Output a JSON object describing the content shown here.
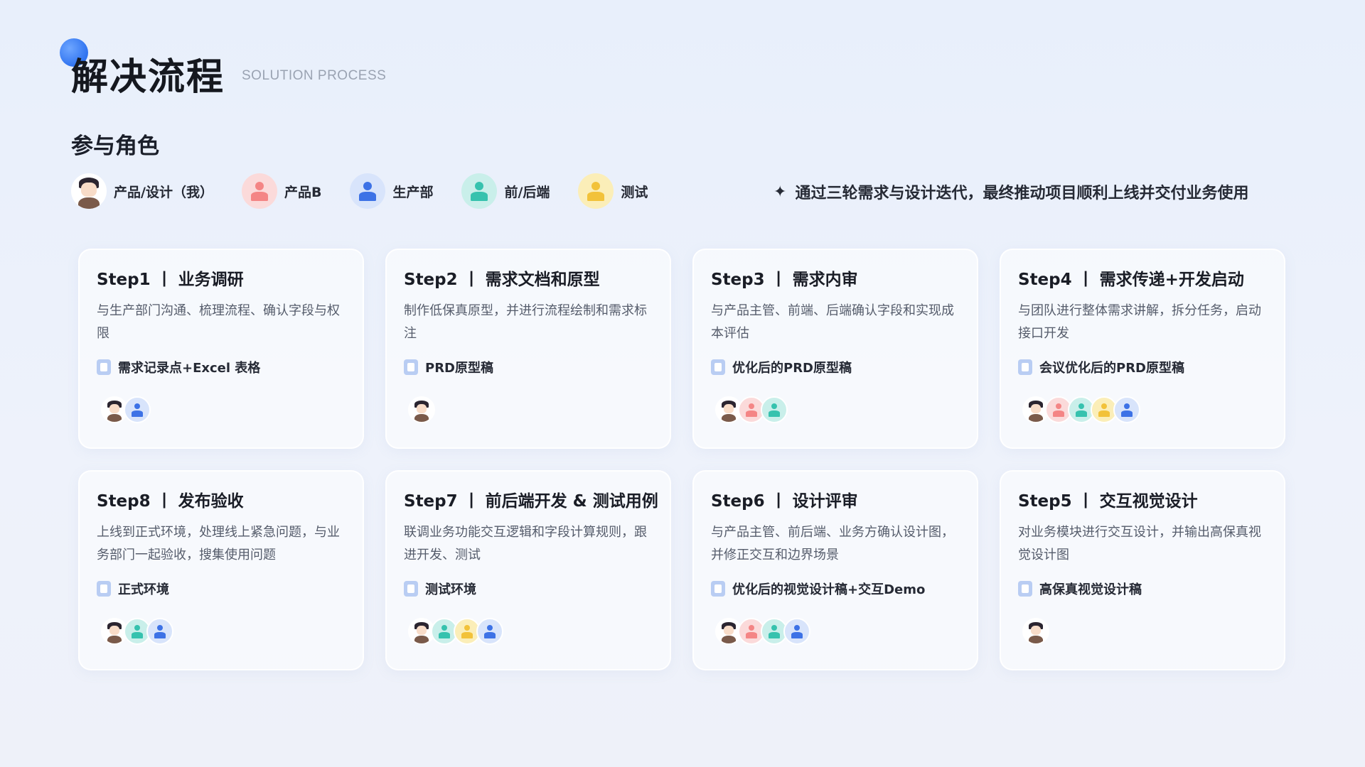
{
  "header": {
    "title": "解决流程",
    "subtitle": "SOLUTION PROCESS"
  },
  "roles_title": "参与角色",
  "roles": [
    {
      "key": "me",
      "label": "产品/设计（我）"
    },
    {
      "key": "pink",
      "label": "产品B"
    },
    {
      "key": "blue",
      "label": "生产部"
    },
    {
      "key": "teal",
      "label": "前/后端"
    },
    {
      "key": "yellow",
      "label": "测试"
    }
  ],
  "slogan": {
    "star": "✦",
    "text": "通过三轮需求与设计迭代，最终推动项目顺利上线并交付业务使用"
  },
  "steps": [
    {
      "title": "Step1 丨 业务调研",
      "desc": "与生产部门沟通、梳理流程、确认字段与权限",
      "doc": "需求记录点+Excel 表格",
      "people": [
        "me",
        "blue"
      ]
    },
    {
      "title": "Step2 丨 需求文档和原型",
      "desc": "制作低保真原型，并进行流程绘制和需求标注",
      "doc": "PRD原型稿",
      "people": [
        "me"
      ]
    },
    {
      "title": "Step3 丨 需求内审",
      "desc": "与产品主管、前端、后端确认字段和实现成本评估",
      "doc": "优化后的PRD原型稿",
      "people": [
        "me",
        "pink",
        "teal"
      ]
    },
    {
      "title": "Step4 丨 需求传递+开发启动",
      "desc": "与团队进行整体需求讲解，拆分任务，启动接口开发",
      "doc": "会议优化后的PRD原型稿",
      "people": [
        "me",
        "pink",
        "teal",
        "yellow",
        "blue"
      ]
    },
    {
      "title": "Step8 丨 发布验收",
      "desc": "上线到正式环境，处理线上紧急问题，与业务部门一起验收，搜集使用问题",
      "doc": "正式环境",
      "people": [
        "me",
        "teal",
        "blue"
      ]
    },
    {
      "title": "Step7 丨 前后端开发 & 测试用例",
      "desc": "联调业务功能交互逻辑和字段计算规则，跟进开发、测试",
      "doc": "测试环境",
      "people": [
        "me",
        "teal",
        "yellow",
        "blue"
      ]
    },
    {
      "title": "Step6 丨 设计评审",
      "desc": "与产品主管、前后端、业务方确认设计图，并修正交互和边界场景",
      "doc": "优化后的视觉设计稿+交互Demo",
      "people": [
        "me",
        "pink",
        "teal",
        "blue"
      ]
    },
    {
      "title": "Step5 丨 交互视觉设计",
      "desc": "对业务模块进行交互设计，并输出高保真视觉设计图",
      "doc": "高保真视觉设计稿",
      "people": [
        "me"
      ]
    }
  ]
}
